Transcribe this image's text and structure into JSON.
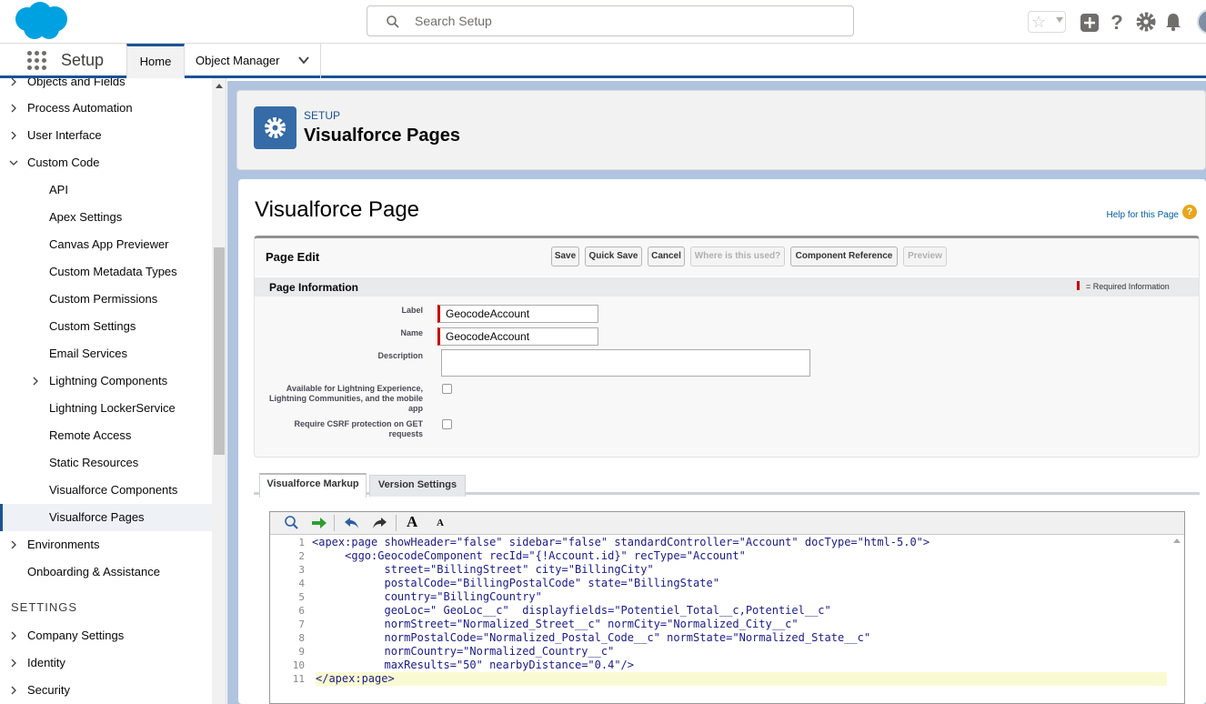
{
  "header": {
    "search_placeholder": "Search Setup"
  },
  "context": {
    "app_name": "Setup",
    "tabs": [
      "Home",
      "Object Manager"
    ]
  },
  "sidebar": {
    "items": [
      {
        "label": "Objects and Fields",
        "expandable": true
      },
      {
        "label": "Process Automation",
        "expandable": true
      },
      {
        "label": "User Interface",
        "expandable": true
      },
      {
        "label": "Custom Code",
        "expandable": true,
        "expanded": true
      },
      {
        "label": "API"
      },
      {
        "label": "Apex Settings"
      },
      {
        "label": "Canvas App Previewer"
      },
      {
        "label": "Custom Metadata Types"
      },
      {
        "label": "Custom Permissions"
      },
      {
        "label": "Custom Settings"
      },
      {
        "label": "Email Services"
      },
      {
        "label": "Lightning Components",
        "expandable": true
      },
      {
        "label": "Lightning LockerService"
      },
      {
        "label": "Remote Access"
      },
      {
        "label": "Static Resources"
      },
      {
        "label": "Visualforce Components"
      },
      {
        "label": "Visualforce Pages",
        "active": true
      },
      {
        "label": "Environments",
        "expandable": true
      },
      {
        "label": "Onboarding & Assistance"
      },
      {
        "label": "Company Settings",
        "expandable": true
      },
      {
        "label": "Identity",
        "expandable": true
      },
      {
        "label": "Security",
        "expandable": true
      }
    ],
    "section_settings": "SETTINGS"
  },
  "page_header": {
    "eyebrow": "SETUP",
    "title": "Visualforce Pages"
  },
  "content": {
    "title": "Visualforce Page",
    "help_link": "Help for this Page",
    "help_icon_glyph": "?"
  },
  "page_edit": {
    "title": "Page Edit",
    "buttons": [
      {
        "label": "Save",
        "enabled": true
      },
      {
        "label": "Quick Save",
        "enabled": true
      },
      {
        "label": "Cancel",
        "enabled": true
      },
      {
        "label": "Where is this used?",
        "enabled": false
      },
      {
        "label": "Component Reference",
        "enabled": true
      },
      {
        "label": "Preview",
        "enabled": false
      }
    ],
    "section_title": "Page Information",
    "required_info": "= Required Information",
    "fields": {
      "label_label": "Label",
      "label_value": "GeocodeAccount",
      "name_label": "Name",
      "name_value": "GeocodeAccount",
      "description_label": "Description",
      "description_value": "",
      "lightning_label": "Available for Lightning Experience, Lightning Communities, and the mobile app",
      "lightning_checked": false,
      "csrf_label": "Require CSRF protection on GET requests",
      "csrf_checked": false
    }
  },
  "tabs": [
    "Visualforce Markup",
    "Version Settings"
  ],
  "toolbar_icons": [
    "search-icon",
    "go-to-line-icon",
    "undo-icon",
    "redo-icon",
    "increase-font-icon",
    "decrease-font-icon"
  ],
  "toolbar_labels": {
    "font_large": "A",
    "font_small": "A"
  },
  "code": {
    "line_numbers": [
      "1",
      "2",
      "3",
      "4",
      "5",
      "6",
      "7",
      "8",
      "9",
      "10",
      "11"
    ],
    "lines": [
      "<apex:page showHeader=\"false\" sidebar=\"false\" standardController=\"Account\" docType=\"html-5.0\">",
      "     <ggo:GeocodeComponent recId=\"{!Account.id}\" recType=\"Account\"",
      "           street=\"BillingStreet\" city=\"BillingCity\"",
      "           postalCode=\"BillingPostalCode\" state=\"BillingState\"",
      "           country=\"BillingCountry\"",
      "           geoLoc=\" GeoLoc__c\"  displayfields=\"Potentiel_Total__c,Potentiel__c\"",
      "           normStreet=\"Normalized_Street__c\" normCity=\"Normalized_City__c\"",
      "           normPostalCode=\"Normalized_Postal_Code__c\" normState=\"Normalized_State__c\"",
      "           normCountry=\"Normalized_Country__c\"",
      "           maxResults=\"50\" nearbyDistance=\"0.4\"/>",
      "</apex:page>"
    ]
  },
  "colors": {
    "brand_blue": "#1b5297",
    "link_blue": "#015ba7",
    "required_red": "#cc0000",
    "salesforce_cloud": "#00a1e0"
  }
}
